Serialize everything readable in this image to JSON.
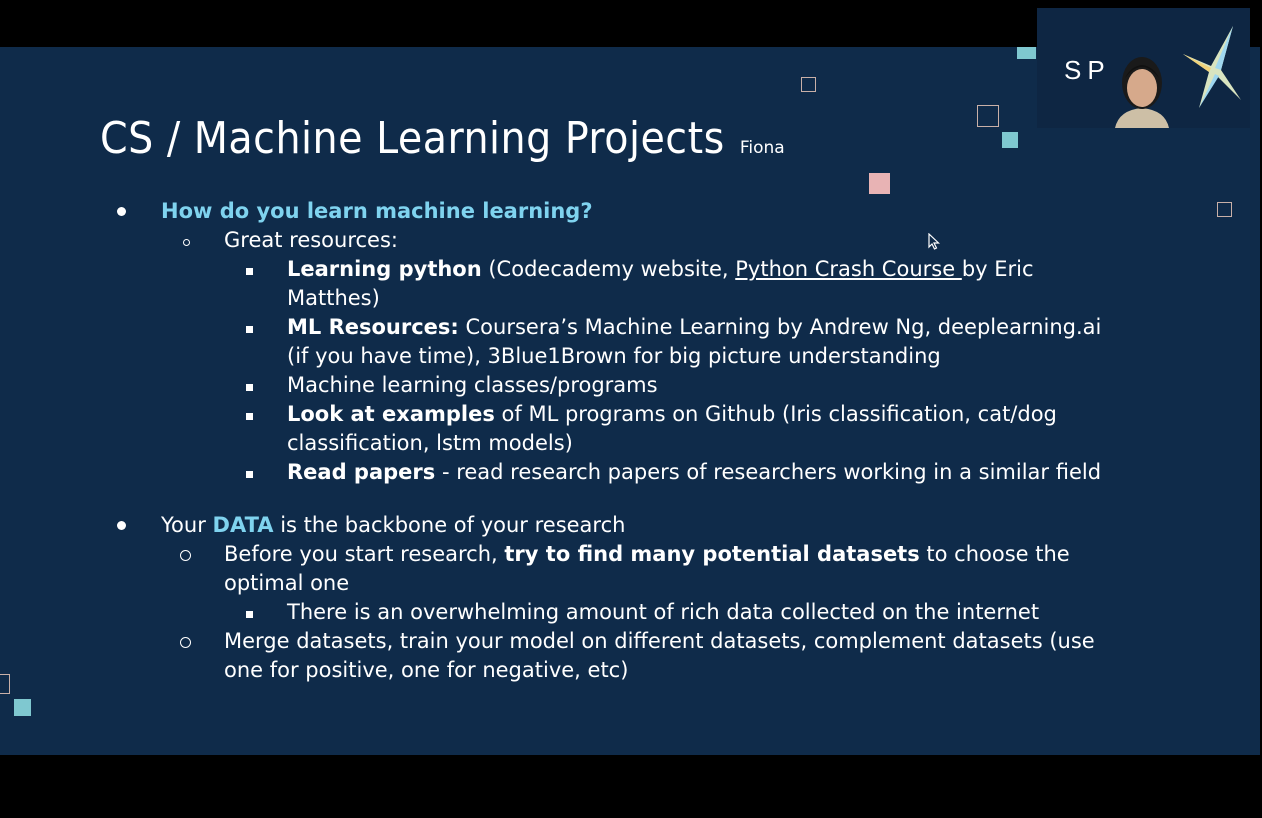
{
  "slide": {
    "title": "CS / Machine Learning Projects",
    "author": "Fiona"
  },
  "content": {
    "b1": {
      "text": "How do you learn machine learning?",
      "color": "#7fd3ef"
    },
    "b1_sub1": "Great resources:",
    "r1_bold": "Learning python",
    "r1_a": " (Codecademy website, ",
    "r1_link": "Python Crash Course ",
    "r1_b": "by Eric",
    "r1_cont": "Matthes)",
    "r2_bold": "ML Resources:",
    "r2_a": " Coursera’s Machine Learning by Andrew Ng, deeplearning.ai",
    "r2_cont": "(if you have time), 3Blue1Brown for big picture understanding",
    "r3": "Machine learning classes/programs",
    "r4_bold": "Look at examples",
    "r4_a": " of ML programs on Github (Iris classification, cat/dog",
    "r4_cont": "classification, lstm models)",
    "r5_bold": "Read papers",
    "r5_a": " - read research papers of researchers working in a similar field",
    "b2_a": "Your ",
    "b2_accent": "DATA",
    "b2_b": " is the backbone of your research",
    "b2_s1_a": "Before you start research, ",
    "b2_s1_bold": "try to find many potential datasets",
    "b2_s1_b": " to choose the",
    "b2_s1_cont": "optimal one",
    "b2_s1_sub": "There is an overwhelming amount of rich data collected on the internet",
    "b2_s2": "Merge datasets, train your model on different datasets, complement datasets (use",
    "b2_s2_cont": "one for positive, one for negative, etc)"
  },
  "webcam": {
    "logo_text": "SP"
  },
  "colors": {
    "slide_bg": "#0f2b4a",
    "accent": "#7fd3ef",
    "square_cyan": "#7fc8d0",
    "square_pink": "#e8b3b4"
  }
}
